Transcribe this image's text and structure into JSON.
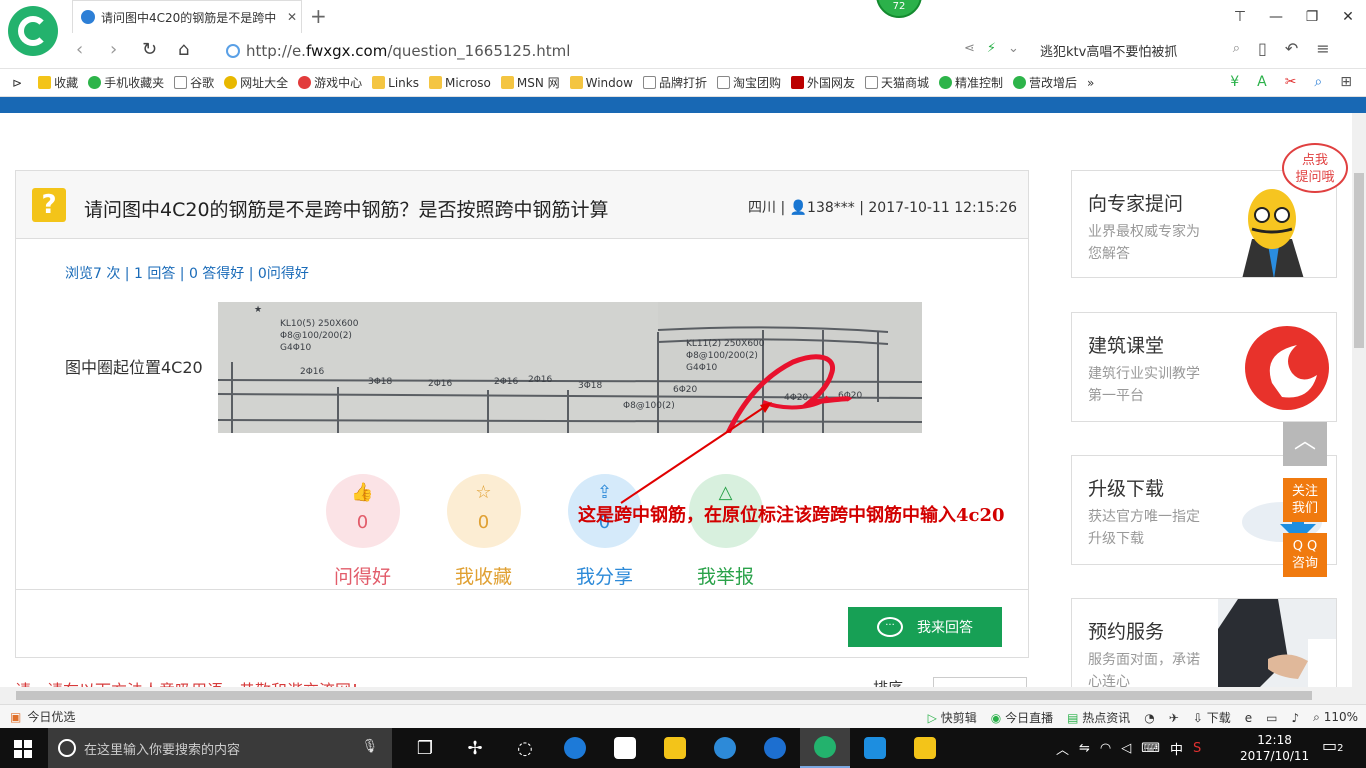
{
  "browser": {
    "tab_title": "请问图中4C20的钢筋是不是跨中",
    "tab_close": "✕",
    "new_tab": "+",
    "badge": "72",
    "url_prefix": "http://e.",
    "url_domain": "fwxgx.com",
    "url_path": "/question_1665125.html",
    "search_text": "逃犯ktv高唱不要怕被抓",
    "window_buttons": [
      "⊤",
      "—",
      "❐",
      "✕"
    ]
  },
  "bookmarks": [
    {
      "label": "收藏",
      "icon": "star-icon"
    },
    {
      "label": "手机收藏夹",
      "icon": "phone-icon"
    },
    {
      "label": "谷歌",
      "icon": "page-icon"
    },
    {
      "label": "网址大全",
      "icon": "globe-icon"
    },
    {
      "label": "游戏中心",
      "icon": "game-icon"
    },
    {
      "label": "Links",
      "icon": "folder-icon"
    },
    {
      "label": "Microso",
      "icon": "folder-icon"
    },
    {
      "label": "MSN 网",
      "icon": "folder-icon"
    },
    {
      "label": "Window",
      "icon": "folder-icon"
    },
    {
      "label": "品牌打折",
      "icon": "page-icon"
    },
    {
      "label": "淘宝团购",
      "icon": "page-icon"
    },
    {
      "label": "外国网友",
      "icon": "flag-icon"
    },
    {
      "label": "天猫商城",
      "icon": "page-icon"
    },
    {
      "label": "精准控制",
      "icon": "wechat-icon"
    },
    {
      "label": "营改增后",
      "icon": "wechat-icon"
    }
  ],
  "question": {
    "icon_char": "?",
    "title": "请问图中4C20的钢筋是不是跨中钢筋？是否按照跨中钢筋计算",
    "meta": "四川 | 👤138*** | 2017-10-11 12:15:26",
    "stats": "浏览7 次 | 1 回答 | 0 答得好 | 0问得好",
    "body_text": "图中圈起位置4C20"
  },
  "actions": [
    {
      "label": "问得好",
      "count": "0",
      "symbol": "👍",
      "color": "#e25c6a",
      "bg": "#fbe3e6"
    },
    {
      "label": "我收藏",
      "count": "0",
      "symbol": "☆",
      "color": "#e0a032",
      "bg": "#fcedd3"
    },
    {
      "label": "我分享",
      "count": "0",
      "symbol": "⇪",
      "color": "#2d8ad8",
      "bg": "#d5eafa"
    },
    {
      "label": "我举报",
      "count": "",
      "symbol": "△",
      "color": "#2aa24a",
      "bg": "#d8f0de"
    }
  ],
  "answer_button": "我来回答",
  "red_notice": "请，请在以下方法人意吸用语，恭敬和谐交流网！",
  "sort_label": "排序",
  "annotation": "这是跨中钢筋，在原位标注该跨跨中钢筋中输入4c20",
  "sidebar": [
    {
      "title": "向专家提问",
      "subtitle": "业界最权威专家为您解答"
    },
    {
      "title": "建筑课堂",
      "subtitle": "建筑行业实训教学第一平台"
    },
    {
      "title": "升级下载",
      "subtitle": "获达官方唯一指定升级下载"
    },
    {
      "title": "预约服务",
      "subtitle": "服务面对面，承诺心连心"
    }
  ],
  "bubble_text": "点我\n提问哦",
  "float_buttons": {
    "scroll_top": "︿",
    "follow": "关注\n我们",
    "qq": "Q Q\n咨询"
  },
  "statusbar": {
    "left": "今日优选",
    "items": [
      "快剪辑",
      "今日直播",
      "热点资讯",
      "下载"
    ],
    "zoom": "110%"
  },
  "taskbar": {
    "search_placeholder": "在这里输入你要搜索的内容",
    "ime": "中",
    "time": "12:18",
    "date": "2017/10/11",
    "notifications": "2"
  },
  "colors": {
    "brand_green": "#17a055",
    "header_blue": "#1868b4",
    "annotation_red": "#d20000"
  }
}
